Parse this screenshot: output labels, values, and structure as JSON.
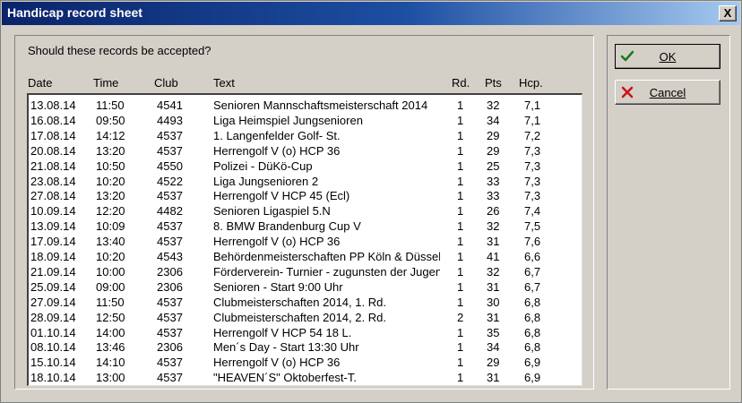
{
  "window": {
    "title": "Handicap record sheet",
    "close_label": "X"
  },
  "question": "Should these records be accepted?",
  "columns": {
    "date": "Date",
    "time": "Time",
    "club": "Club",
    "text": "Text",
    "rd": "Rd.",
    "pts": "Pts",
    "hcp": "Hcp."
  },
  "rows": [
    {
      "date": "13.08.14",
      "time": "11:50",
      "club": "4541",
      "text": "Senioren Mannschaftsmeisterschaft 2014",
      "rd": "1",
      "pts": "32",
      "hcp": "7,1"
    },
    {
      "date": "16.08.14",
      "time": "09:50",
      "club": "4493",
      "text": "Liga Heimspiel Jungsenioren",
      "rd": "1",
      "pts": "34",
      "hcp": "7,1"
    },
    {
      "date": "17.08.14",
      "time": "14:12",
      "club": "4537",
      "text": "1. Langenfelder Golf- St.",
      "rd": "1",
      "pts": "29",
      "hcp": "7,2"
    },
    {
      "date": "20.08.14",
      "time": "13:20",
      "club": "4537",
      "text": "Herrengolf V (o) HCP 36",
      "rd": "1",
      "pts": "29",
      "hcp": "7,3"
    },
    {
      "date": "21.08.14",
      "time": "10:50",
      "club": "4550",
      "text": "Polizei - DüKö-Cup",
      "rd": "1",
      "pts": "25",
      "hcp": "7,3"
    },
    {
      "date": "23.08.14",
      "time": "10:20",
      "club": "4522",
      "text": "Liga Jungsenioren 2",
      "rd": "1",
      "pts": "33",
      "hcp": "7,3"
    },
    {
      "date": "27.08.14",
      "time": "13:20",
      "club": "4537",
      "text": "Herrengolf V HCP 45 (Ecl)",
      "rd": "1",
      "pts": "33",
      "hcp": "7,3"
    },
    {
      "date": "10.09.14",
      "time": "12:20",
      "club": "4482",
      "text": "Senioren Ligaspiel 5.N",
      "rd": "1",
      "pts": "26",
      "hcp": "7,4"
    },
    {
      "date": "13.09.14",
      "time": "10:09",
      "club": "4537",
      "text": "8. BMW Brandenburg Cup V",
      "rd": "1",
      "pts": "32",
      "hcp": "7,5"
    },
    {
      "date": "17.09.14",
      "time": "13:40",
      "club": "4537",
      "text": "Herrengolf V (o) HCP 36",
      "rd": "1",
      "pts": "31",
      "hcp": "7,6"
    },
    {
      "date": "18.09.14",
      "time": "10:20",
      "club": "4543",
      "text": "Behördenmeisterschaften PP Köln & Düsseldorf",
      "rd": "1",
      "pts": "41",
      "hcp": "6,6"
    },
    {
      "date": "21.09.14",
      "time": "10:00",
      "club": "2306",
      "text": "Förderverein- Turnier - zugunsten der Jugend",
      "rd": "1",
      "pts": "32",
      "hcp": "6,7"
    },
    {
      "date": "25.09.14",
      "time": "09:00",
      "club": "2306",
      "text": "Senioren - Start 9:00 Uhr",
      "rd": "1",
      "pts": "31",
      "hcp": "6,7"
    },
    {
      "date": "27.09.14",
      "time": "11:50",
      "club": "4537",
      "text": "Clubmeisterschaften 2014, 1. Rd.",
      "rd": "1",
      "pts": "30",
      "hcp": "6,8"
    },
    {
      "date": "28.09.14",
      "time": "12:50",
      "club": "4537",
      "text": "Clubmeisterschaften 2014, 2. Rd.",
      "rd": "2",
      "pts": "31",
      "hcp": "6,8"
    },
    {
      "date": "01.10.14",
      "time": "14:00",
      "club": "4537",
      "text": "Herrengolf V HCP 54 18 L.",
      "rd": "1",
      "pts": "35",
      "hcp": "6,8"
    },
    {
      "date": "08.10.14",
      "time": "13:46",
      "club": "2306",
      "text": "Men´s Day - Start 13:30 Uhr",
      "rd": "1",
      "pts": "34",
      "hcp": "6,8"
    },
    {
      "date": "15.10.14",
      "time": "14:10",
      "club": "4537",
      "text": "Herrengolf V (o) HCP 36",
      "rd": "1",
      "pts": "29",
      "hcp": "6,9"
    },
    {
      "date": "18.10.14",
      "time": "13:00",
      "club": "4537",
      "text": "\"HEAVEN´S\" Oktoberfest-T.",
      "rd": "1",
      "pts": "31",
      "hcp": "6,9"
    }
  ],
  "buttons": {
    "ok": {
      "label": "OK",
      "icon": "checkmark-icon",
      "color": "#1a7a1a"
    },
    "cancel": {
      "label": "Cancel",
      "icon": "cross-icon",
      "color": "#cc1111"
    }
  }
}
